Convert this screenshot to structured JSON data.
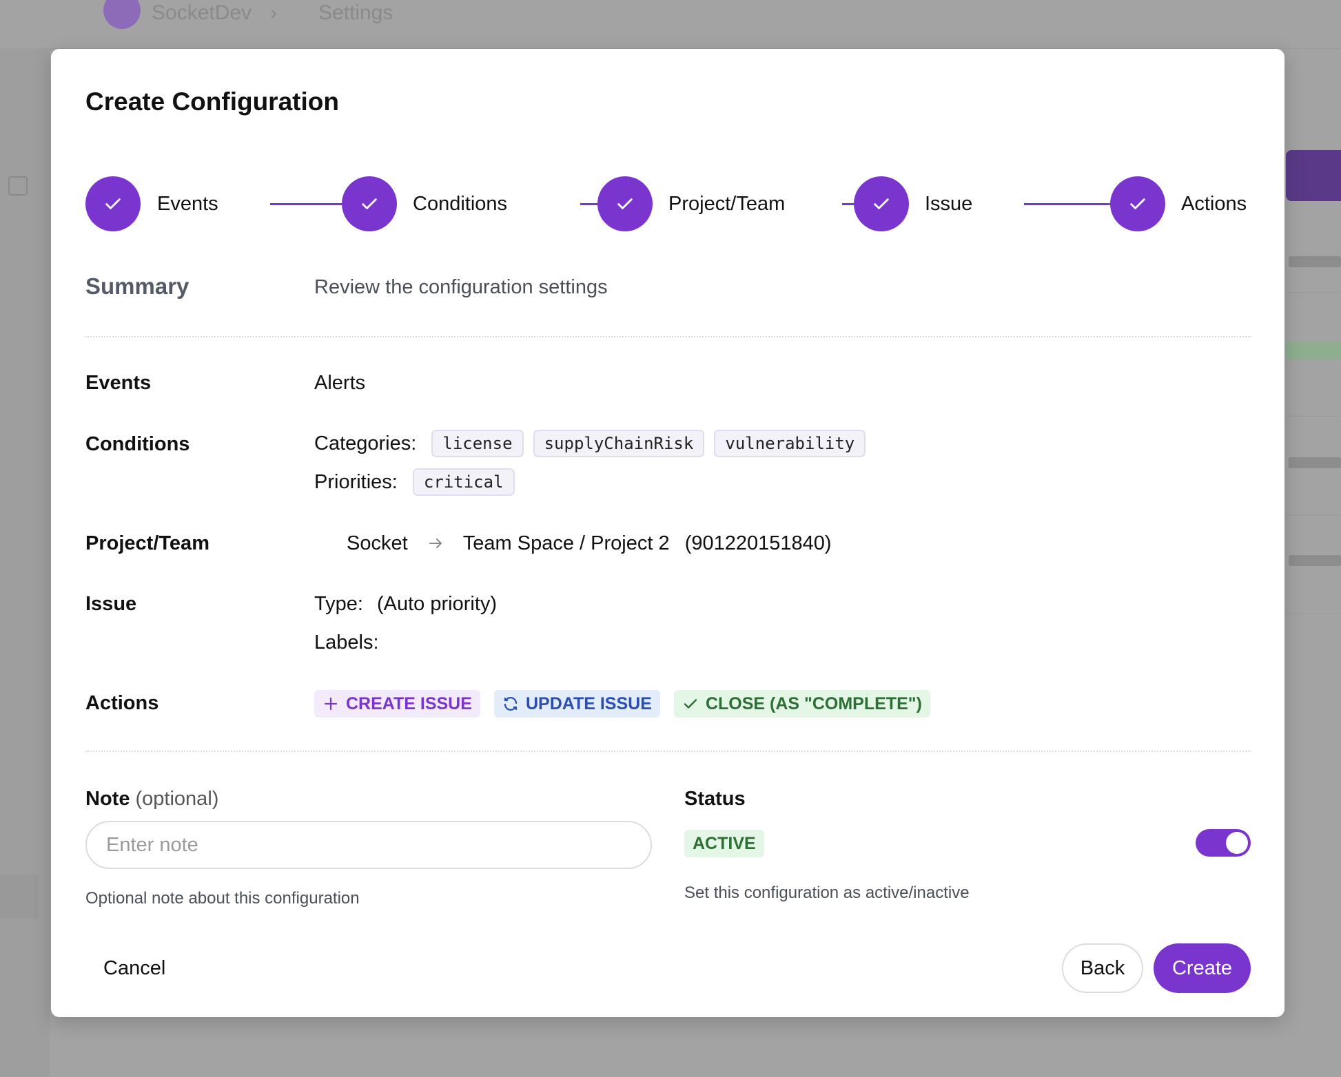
{
  "background": {
    "breadcrumb": [
      "SocketDev",
      "Settings"
    ]
  },
  "modal": {
    "title": "Create Configuration",
    "steps": [
      {
        "label": "Events"
      },
      {
        "label": "Conditions"
      },
      {
        "label": "Project/Team"
      },
      {
        "label": "Issue"
      },
      {
        "label": "Actions"
      }
    ],
    "summary": {
      "title": "Summary",
      "description": "Review the configuration settings"
    },
    "events": {
      "label": "Events",
      "value": "Alerts"
    },
    "conditions": {
      "label": "Conditions",
      "categories_label": "Categories:",
      "categories": [
        "license",
        "supplyChainRisk",
        "vulnerability"
      ],
      "priorities_label": "Priorities:",
      "priorities": [
        "critical"
      ]
    },
    "project_team": {
      "label": "Project/Team",
      "source": "Socket",
      "destination": "Team Space / Project 2",
      "id": "(901220151840)"
    },
    "issue": {
      "label": "Issue",
      "type_label": "Type:",
      "type_value": "(Auto priority)",
      "labels_label": "Labels:",
      "labels_value": ""
    },
    "actions": {
      "label": "Actions",
      "items": [
        "CREATE ISSUE",
        "UPDATE ISSUE",
        "CLOSE (AS \"COMPLETE\")"
      ]
    },
    "note": {
      "label": "Note",
      "optional": "(optional)",
      "placeholder": "Enter note",
      "value": "",
      "help": "Optional note about this configuration"
    },
    "status": {
      "label": "Status",
      "badge": "ACTIVE",
      "enabled": true,
      "help": "Set this configuration as active/inactive"
    },
    "footer": {
      "cancel": "Cancel",
      "back": "Back",
      "create": "Create"
    }
  },
  "colors": {
    "accent": "#7b35cf",
    "success_bg": "#e4f6e6",
    "success_text": "#2d6f35",
    "info_bg": "#e2ecfb",
    "info_text": "#2a4fb0"
  }
}
